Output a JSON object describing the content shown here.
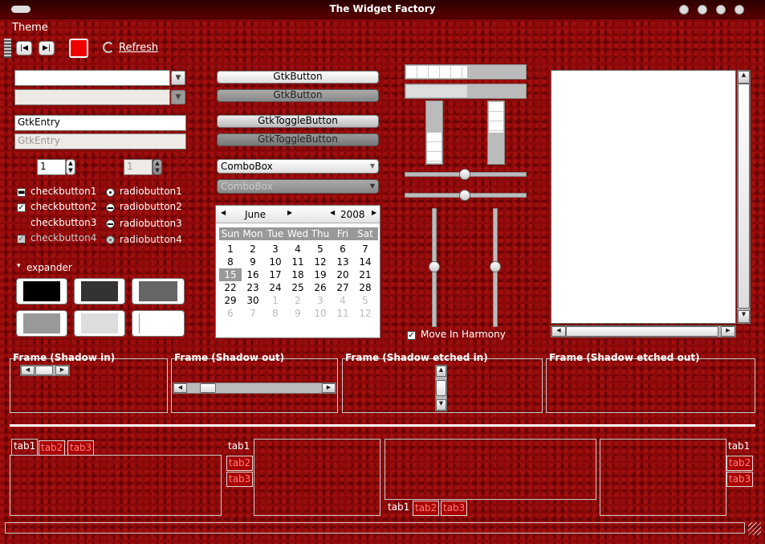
{
  "window": {
    "title": "The Widget Factory"
  },
  "menubar": {
    "theme": "Theme"
  },
  "toolbar": {
    "refresh": "Refresh"
  },
  "entries": {
    "gtk_entry": "GtkEntry",
    "gtk_entry_insensitive": "GtkEntry"
  },
  "spins": {
    "spin1": "1",
    "spin2": "1"
  },
  "checks": [
    {
      "label": "checkbutton1",
      "state": "mixed"
    },
    {
      "label": "checkbutton2",
      "state": "checked"
    },
    {
      "label": "checkbutton3",
      "state": "unchecked"
    },
    {
      "label": "checkbutton4",
      "state": "checked-insensitive"
    }
  ],
  "radios": [
    {
      "label": "radiobutton1",
      "state": "selected"
    },
    {
      "label": "radiobutton2",
      "state": "mixed"
    },
    {
      "label": "radiobutton3",
      "state": "mixed"
    },
    {
      "label": "radiobutton4",
      "state": "selected-insensitive"
    }
  ],
  "expander": {
    "label": "expander"
  },
  "buttons": {
    "gtkbutton": "GtkButton",
    "gtkbutton_ins": "GtkButton",
    "toggle": "GtkToggleButton",
    "toggle_ins": "GtkToggleButton",
    "combobox": "ComboBox",
    "combobox_ins": "ComboBox"
  },
  "calendar": {
    "month": "June",
    "year": "2008",
    "days": [
      "Sun",
      "Mon",
      "Tue",
      "Wed",
      "Thu",
      "Fri",
      "Sat"
    ],
    "rows": [
      [
        "1",
        "2",
        "3",
        "4",
        "5",
        "6",
        "7"
      ],
      [
        "8",
        "9",
        "10",
        "11",
        "12",
        "13",
        "14"
      ],
      [
        "15",
        "16",
        "17",
        "18",
        "19",
        "20",
        "21"
      ],
      [
        "22",
        "23",
        "24",
        "25",
        "26",
        "27",
        "28"
      ],
      [
        "29",
        "30",
        "1",
        "2",
        "3",
        "4",
        "5"
      ],
      [
        "6",
        "7",
        "8",
        "9",
        "10",
        "11",
        "12"
      ]
    ],
    "selected": "15"
  },
  "harmony": {
    "label": "Move In Harmony",
    "checked": true
  },
  "frames": {
    "shadow_in": "Frame (Shadow in)",
    "shadow_out": "Frame (Shadow out)",
    "etched_in": "Frame (Shadow etched in)",
    "etched_out": "Frame (Shadow etched out)"
  },
  "tabs": {
    "t1": "tab1",
    "t2": "tab2",
    "t3": "tab3"
  },
  "colors": {
    "background": "#8a0808",
    "accent_tab": "#ff8080"
  }
}
